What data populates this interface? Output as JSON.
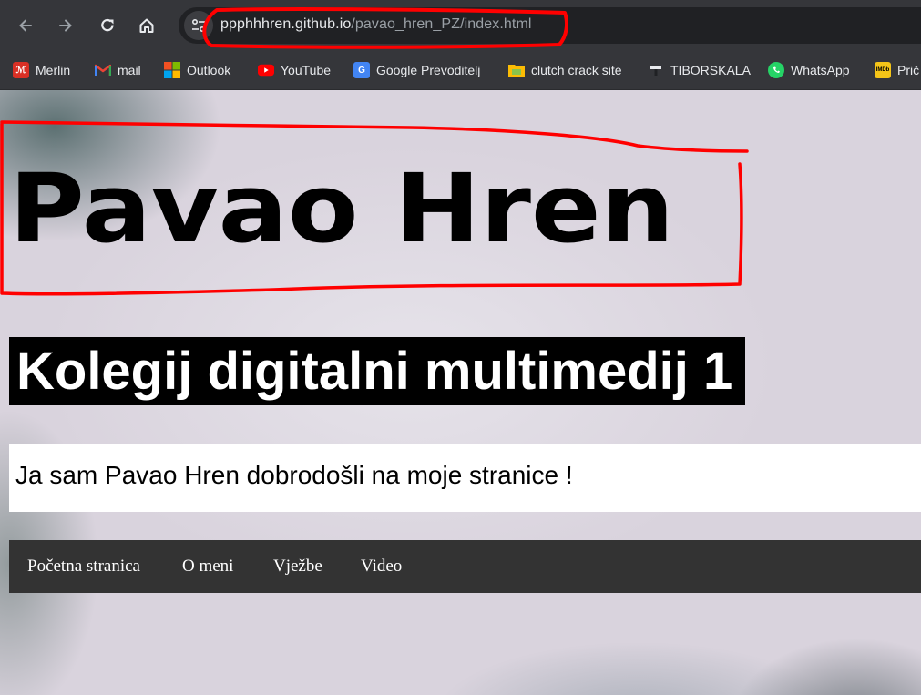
{
  "browser": {
    "url_host": "ppphhhren.github.io",
    "url_path": "/pavao_hren_PZ/index.html"
  },
  "bookmarks": [
    {
      "label": "Merlin",
      "icon": "merlin-icon",
      "color": "#d93025"
    },
    {
      "label": "mail",
      "icon": "gmail-icon",
      "color": "#ea4335"
    },
    {
      "label": "Outlook",
      "icon": "outlook-icon",
      "color": "#0078d4"
    },
    {
      "label": "YouTube",
      "icon": "youtube-icon",
      "color": "#ff0000"
    },
    {
      "label": "Google Prevoditelj",
      "icon": "google-translate-icon",
      "color": "#4285f4"
    },
    {
      "label": "clutch crack site",
      "icon": "folder-icon",
      "color": "#8bc34a"
    },
    {
      "label": "TIBORSKALA",
      "icon": "tiborskala-icon",
      "color": "#202124"
    },
    {
      "label": "WhatsApp",
      "icon": "whatsapp-icon",
      "color": "#25d366"
    },
    {
      "label": "Prič",
      "icon": "imdb-icon",
      "color": "#f5c518"
    }
  ],
  "page": {
    "logo_text": "Pavao Hren",
    "course_title": "Kolegij digitalni multimedij 1",
    "welcome_text": "Ja sam Pavao Hren dobrodošli na moje stranice !",
    "nav": [
      {
        "label": "Početna stranica"
      },
      {
        "label": "O meni"
      },
      {
        "label": "Vježbe"
      },
      {
        "label": "Video"
      }
    ]
  },
  "annotation_color": "#ff0000"
}
